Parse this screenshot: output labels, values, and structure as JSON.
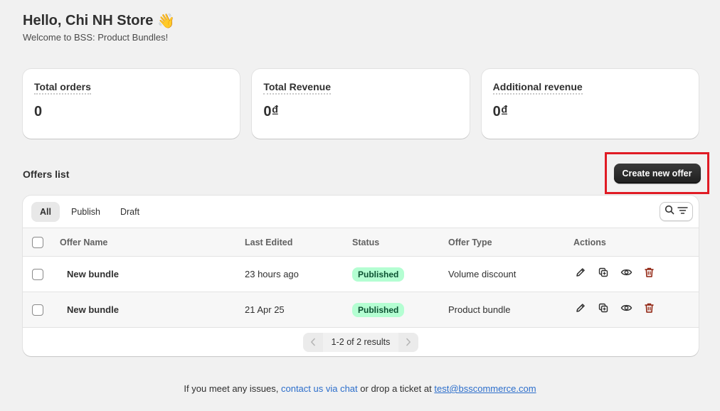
{
  "header": {
    "greeting": "Hello, Chi NH Store",
    "wave_emoji": "👋",
    "welcome": "Welcome to BSS: Product Bundles!"
  },
  "stats": [
    {
      "label": "Total orders",
      "value": "0"
    },
    {
      "label": "Total Revenue",
      "value": "0₫"
    },
    {
      "label": "Additional revenue",
      "value": "0₫"
    }
  ],
  "offers": {
    "title": "Offers list",
    "create_label": "Create new offer",
    "tabs": [
      {
        "label": "All",
        "active": true
      },
      {
        "label": "Publish",
        "active": false
      },
      {
        "label": "Draft",
        "active": false
      }
    ],
    "columns": {
      "name": "Offer Name",
      "edited": "Last Edited",
      "status": "Status",
      "type": "Offer Type",
      "actions": "Actions"
    },
    "rows": [
      {
        "name": "New bundle",
        "edited": "23 hours ago",
        "status": "Published",
        "type": "Volume discount"
      },
      {
        "name": "New bundle",
        "edited": "21 Apr 25",
        "status": "Published",
        "type": "Product bundle"
      }
    ],
    "pagination": {
      "text": "1-2 of 2 results"
    }
  },
  "footer": {
    "prefix": "If you meet any issues,",
    "chat_link": "contact us via chat",
    "middle": "or drop a ticket at",
    "email": "test@bsscommerce.com"
  },
  "colors": {
    "badge_bg": "#b4fed2",
    "link": "#2c6ecb",
    "delete_icon": "#8e1f0b",
    "highlight_border": "#e01b24"
  }
}
